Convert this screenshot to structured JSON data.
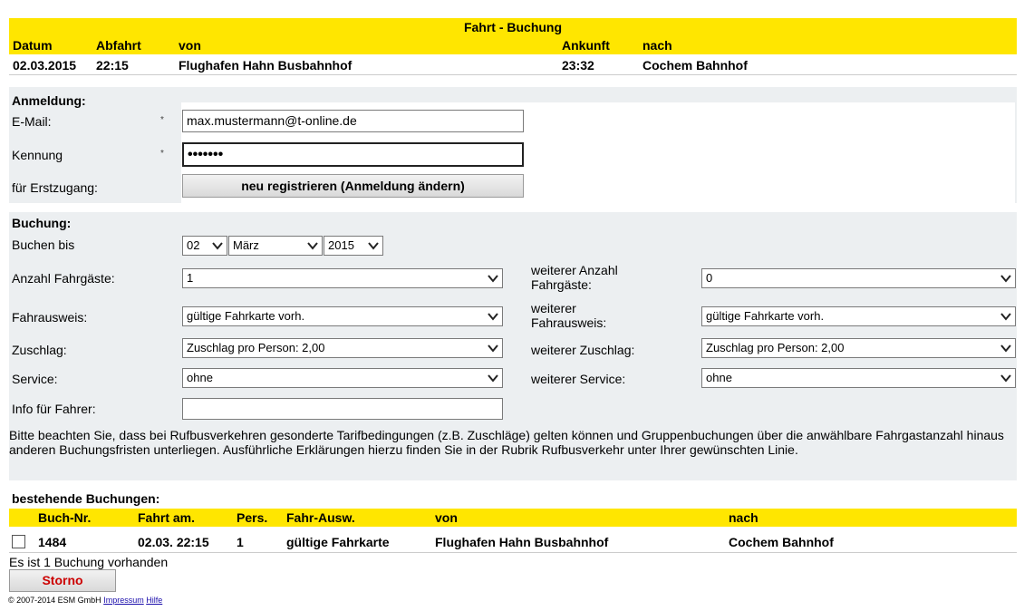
{
  "trip": {
    "title": "Fahrt - Buchung",
    "headers": {
      "datum": "Datum",
      "abfahrt": "Abfahrt",
      "von": "von",
      "ankunft": "Ankunft",
      "nach": "nach"
    },
    "row": {
      "datum": "02.03.2015",
      "abfahrt": "22:15",
      "von": "Flughafen Hahn Busbahnhof",
      "ankunft": "23:32",
      "nach": "Cochem Bahnhof"
    }
  },
  "login": {
    "heading": "Anmeldung:",
    "email_label": "E-Mail:",
    "email_value": "max.mustermann@t-online.de",
    "kennung_label": "Kennung",
    "kennung_value": "•••••••",
    "required_mark": "*",
    "erstzugang_label": "für Erstzugang:",
    "register_button": "neu registrieren (Anmeldung ändern)"
  },
  "booking": {
    "heading": "Buchung:",
    "buchen_bis_label": "Buchen bis",
    "day": "02",
    "month": "März",
    "year": "2015",
    "anzahl_label": "Anzahl Fahrgäste:",
    "anzahl_value": "1",
    "weitere_anzahl_label_1": "weiterer Anzahl",
    "weitere_anzahl_label_2": "Fahrgäste:",
    "weitere_anzahl_value": "0",
    "fahrausweis_label": "Fahrausweis:",
    "fahrausweis_value": "gültige Fahrkarte vorh.",
    "weiterer_fahrausweis_label_1": "weiterer",
    "weiterer_fahrausweis_label_2": "Fahrausweis:",
    "weiterer_fahrausweis_value": "gültige Fahrkarte vorh.",
    "zuschlag_label": "Zuschlag:",
    "zuschlag_value": "Zuschlag pro Person: 2,00",
    "weiterer_zuschlag_label": "weiterer Zuschlag:",
    "weiterer_zuschlag_value": "Zuschlag pro Person: 2,00",
    "service_label": "Service:",
    "service_value": "ohne",
    "weiterer_service_label": "weiterer Service:",
    "weiterer_service_value": "ohne",
    "info_label": "Info für Fahrer:",
    "info_value": "",
    "notice": "Bitte beachten Sie, dass bei Rufbusverkehren gesonderte Tarifbedingungen (z.B. Zuschläge) gelten können und Gruppenbuchungen über die anwählbare Fahrgastanzahl hinaus anderen Buchungsfristen unterliegen. Ausführliche Erklärungen hierzu finden Sie in der Rubrik Rufbusverkehr unter Ihrer gewünschten Linie."
  },
  "existing": {
    "heading": "bestehende Buchungen:",
    "headers": {
      "nr": "Buch-Nr.",
      "fahrt": "Fahrt am.",
      "pers": "Pers.",
      "ausw": "Fahr-Ausw.",
      "von": "von",
      "nach": "nach"
    },
    "row": {
      "nr": "1484",
      "fahrt": "02.03. 22:15",
      "pers": "1",
      "ausw": "gültige Fahrkarte",
      "von": "Flughafen Hahn Busbahnhof",
      "nach": "Cochem Bahnhof"
    },
    "count_text": "Es ist 1 Buchung vorhanden",
    "storno_button": "Storno"
  },
  "footer": {
    "copyright": "© 2007-2014 ESM GmbH",
    "impressum": "Impressum",
    "hilfe": "Hilfe"
  },
  "colors": {
    "header_yellow": "#ffe600",
    "section_gray": "#eceff1",
    "storno_red": "#cc0000"
  }
}
